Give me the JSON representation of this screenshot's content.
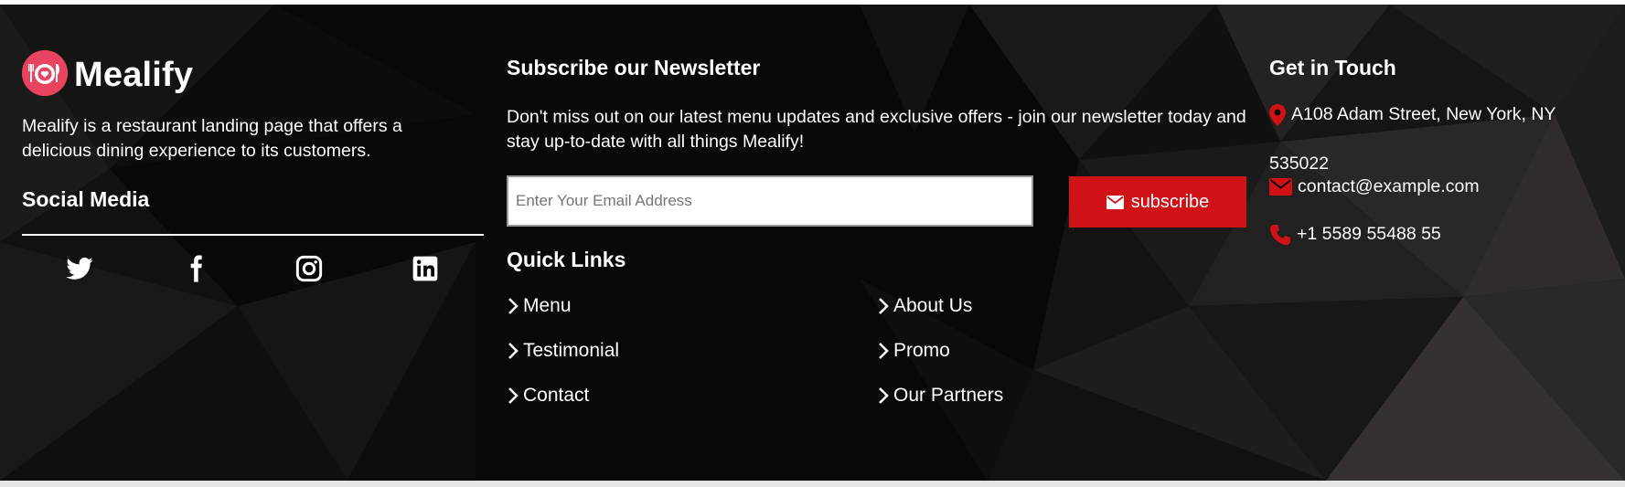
{
  "brand": {
    "name": "Mealify",
    "description": "Mealify is a restaurant landing page that offers a delicious dining experience to its customers.",
    "logo_color": "#e9445f"
  },
  "social": {
    "title": "Social Media",
    "icons": [
      "twitter-icon",
      "facebook-icon",
      "instagram-icon",
      "linkedin-icon"
    ]
  },
  "newsletter": {
    "title": "Subscribe our Newsletter",
    "text": "Don't miss out on our latest menu updates and exclusive offers - join our newsletter today and stay up-to-date with all things Mealify!",
    "placeholder": "Enter Your Email Address",
    "value": "",
    "button_label": "subscribe",
    "button_icon": "envelope-icon",
    "button_color": "#d01217"
  },
  "quick_links": {
    "title": "Quick Links",
    "items": [
      {
        "label": "Menu"
      },
      {
        "label": "About Us"
      },
      {
        "label": "Testimonial"
      },
      {
        "label": "Promo"
      },
      {
        "label": "Contact"
      },
      {
        "label": "Our Partners"
      }
    ]
  },
  "contact": {
    "title": "Get in Touch",
    "address_line1": "A108 Adam Street, New York, NY",
    "address_line2": "535022",
    "email": "contact@example.com",
    "phone": "+1 5589 55488 55",
    "accent_color": "#d01217"
  }
}
